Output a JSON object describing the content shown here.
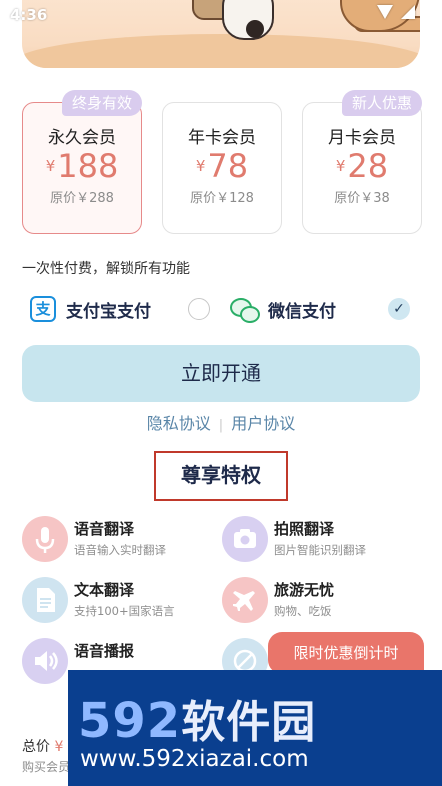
{
  "status_bar": {
    "time": "4:36"
  },
  "banner": {
    "speech_text": ""
  },
  "plans": [
    {
      "name": "永久会员",
      "currency": "¥",
      "price": "188",
      "original": "原价￥288",
      "badge": "终身有效",
      "selected": true
    },
    {
      "name": "年卡会员",
      "currency": "¥",
      "price": "78",
      "original": "原价￥128",
      "badge": "",
      "selected": false
    },
    {
      "name": "月卡会员",
      "currency": "¥",
      "price": "28",
      "original": "原价￥38",
      "badge": "新人优惠",
      "selected": false
    }
  ],
  "description": "一次性付费，解锁所有功能",
  "payment": {
    "alipay_label": "支付宝支付",
    "alipay_icon_char": "支",
    "wechat_label": "微信支付",
    "selected": "wechat",
    "check_glyph": "✓"
  },
  "cta_label": "立即开通",
  "links": {
    "privacy": "隐私协议",
    "separator": "|",
    "terms": "用户协议"
  },
  "privileges": {
    "title": "尊享特权",
    "items": [
      {
        "title": "语音翻译",
        "subtitle": "语音输入实时翻译",
        "icon": "microphone-icon",
        "color": "#f6c5c5"
      },
      {
        "title": "拍照翻译",
        "subtitle": "图片智能识别翻译",
        "icon": "camera-icon",
        "color": "#d8d0f1"
      },
      {
        "title": "文本翻译",
        "subtitle": "支持100+国家语言",
        "icon": "document-icon",
        "color": "#cfe4f0"
      },
      {
        "title": "旅游无忧",
        "subtitle": "购物、吃饭",
        "icon": "airplane-icon",
        "color": "#f6c5c5"
      },
      {
        "title": "语音播报",
        "subtitle": "",
        "icon": "speaker-icon",
        "color": "#d8d0f1"
      },
      {
        "title": "",
        "subtitle": "",
        "icon": "no-ads-icon",
        "color": "#cfe4f0"
      }
    ]
  },
  "countdown_toast": "限时优惠倒计时",
  "footer": {
    "total_label": "总价",
    "total_value": "¥",
    "buy_hint": "购买会员"
  },
  "watermark": {
    "logo_digits": "592",
    "logo_text": "软件园",
    "url": "www.592xiazai.com"
  },
  "colors": {
    "accent": "#e07b6e",
    "cta": "#c7e5ee",
    "badge": "#d9ccee",
    "toast": "#e9756a",
    "watermark": "#0a3f8f"
  }
}
